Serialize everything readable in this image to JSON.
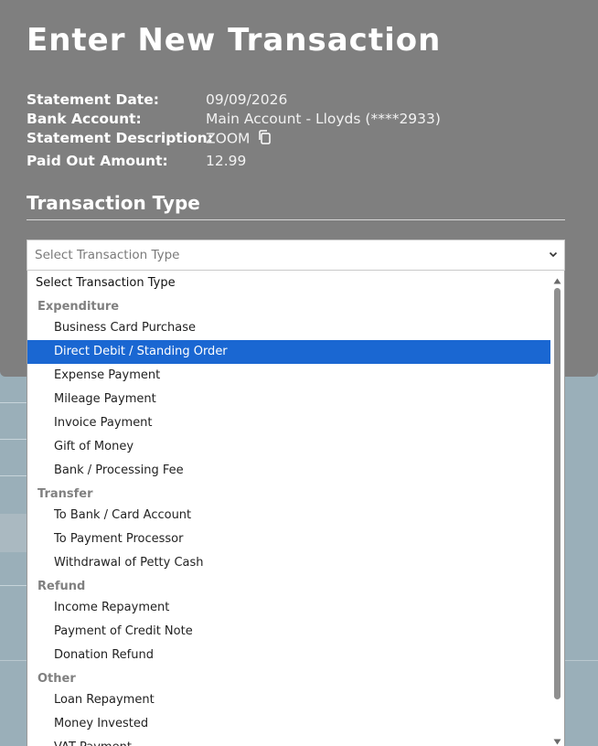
{
  "modal": {
    "title": "Enter New Transaction",
    "details": [
      {
        "label": "Statement Date:",
        "value": "09/09/2026"
      },
      {
        "label": "Bank Account:",
        "value": "Main Account - Lloyds (****2933)"
      },
      {
        "label": "Statement Description:",
        "value": "ZOOM"
      },
      {
        "label": "Paid Out Amount:",
        "value": "12.99"
      }
    ],
    "section_title": "Transaction Type"
  },
  "select": {
    "placeholder": "Select Transaction Type",
    "selected": "Direct Debit / Standing Order"
  },
  "dropdown": {
    "first_option": "Select Transaction Type",
    "items": [
      {
        "type": "group",
        "label": "Expenditure"
      },
      {
        "type": "child",
        "label": "Business Card Purchase"
      },
      {
        "type": "child",
        "label": "Direct Debit / Standing Order"
      },
      {
        "type": "child",
        "label": "Expense Payment"
      },
      {
        "type": "child",
        "label": "Mileage Payment"
      },
      {
        "type": "child",
        "label": "Invoice Payment"
      },
      {
        "type": "child",
        "label": "Gift of Money"
      },
      {
        "type": "child",
        "label": "Bank / Processing Fee"
      },
      {
        "type": "group",
        "label": "Transfer"
      },
      {
        "type": "child",
        "label": "To Bank / Card Account"
      },
      {
        "type": "child",
        "label": "To Payment Processor"
      },
      {
        "type": "child",
        "label": "Withdrawal of Petty Cash"
      },
      {
        "type": "group",
        "label": "Refund"
      },
      {
        "type": "child",
        "label": "Income Repayment"
      },
      {
        "type": "child",
        "label": "Payment of Credit Note"
      },
      {
        "type": "child",
        "label": "Donation Refund"
      },
      {
        "type": "group",
        "label": "Other"
      },
      {
        "type": "child",
        "label": "Loan Repayment"
      },
      {
        "type": "child",
        "label": "Money Invested"
      },
      {
        "type": "child",
        "label": "VAT Payment"
      }
    ]
  },
  "colors": {
    "modal_bg": "#7f7f7f",
    "page_bg": "#9aafb9",
    "selected_bg": "#1a67d2",
    "group_text": "#808080"
  },
  "icons": {
    "copy": "copy-icon",
    "chevron": "chevron-down-icon",
    "scroll_up": "arrow-up-icon",
    "scroll_down": "arrow-down-icon"
  }
}
